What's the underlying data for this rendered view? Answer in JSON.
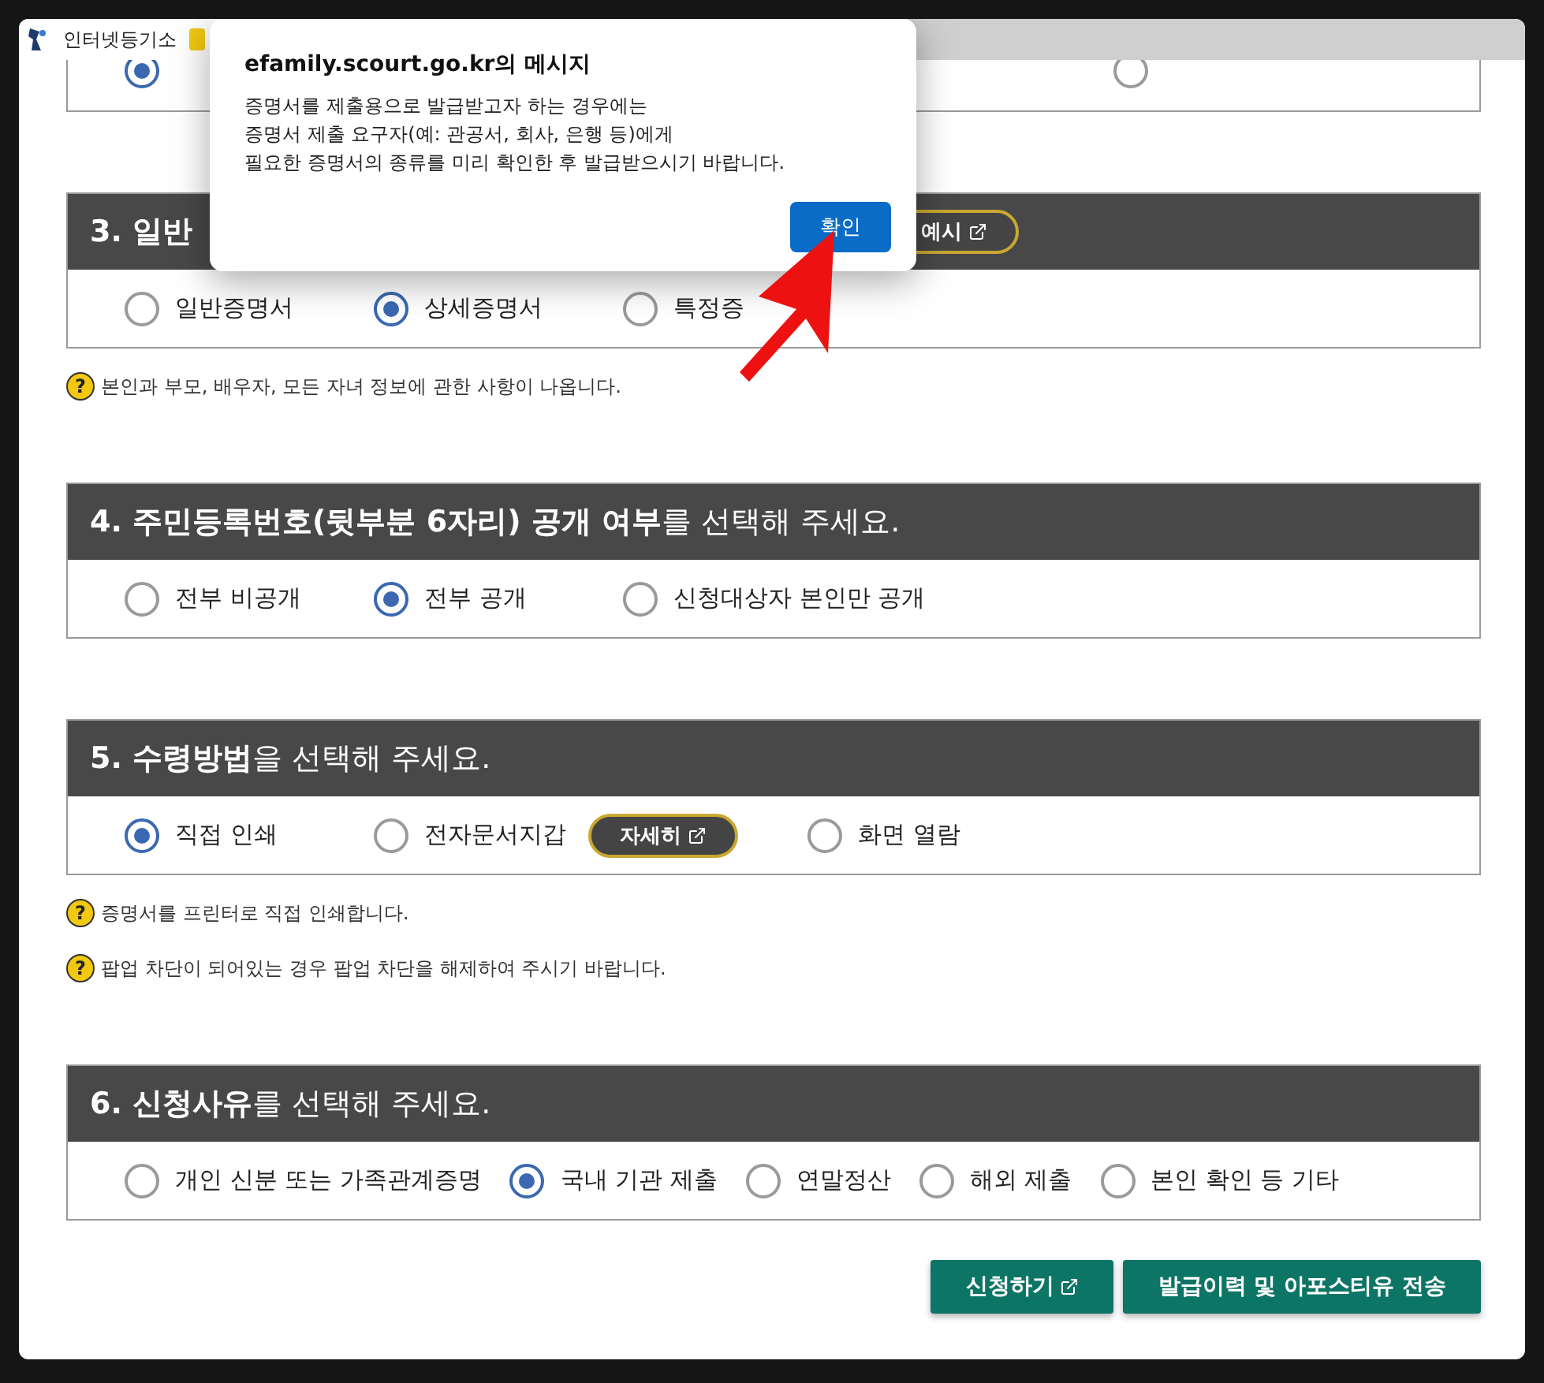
{
  "bookmark_bar": {
    "items": [
      {
        "label": "인터넷등기소"
      }
    ]
  },
  "sections": [
    {
      "kind": "spread",
      "options": [
        {
          "selected": true
        },
        {
          "selected": false
        }
      ]
    },
    {
      "kind": "wide",
      "title": "**3. 일반**",
      "header_button": "예시",
      "options": [
        {
          "label": "일반증명서",
          "selected": false
        },
        {
          "label": "상세증명서",
          "selected": true
        },
        {
          "label": "특정증",
          "selected": false
        }
      ],
      "notes": [
        {
          "icon": "?",
          "text": "본인과 부모, 배우자, 모든 자녀 정보에 관한 사항이 나옵니다."
        }
      ]
    },
    {
      "kind": "wide",
      "title": "**4. 주민등록번호(뒷부분 6자리) 공개 여부**를 선택해 주세요.",
      "options": [
        {
          "label": "전부 비공개",
          "selected": false
        },
        {
          "label": "전부 공개",
          "selected": true
        },
        {
          "label": "신청대상자 본인만 공개",
          "selected": false
        }
      ]
    },
    {
      "kind": "wide",
      "title": "**5. 수령방법**을 선택해 주세요.",
      "options": [
        {
          "label": "직접 인쇄",
          "selected": true
        },
        {
          "label": "전자문서지갑",
          "selected": false,
          "button": "자세히"
        },
        {
          "label": "화면 열람",
          "selected": false
        }
      ],
      "notes": [
        {
          "icon": "?",
          "text": "증명서를 프린터로 직접 인쇄합니다."
        },
        {
          "icon": "?",
          "text": "팝업 차단이 되어있는 경우 팝업 차단을 해제하여 주시기 바랍니다."
        }
      ]
    },
    {
      "kind": "compact",
      "title": "**6. 신청사유**를 선택해 주세요.",
      "options": [
        {
          "label": "개인 신분 또는 가족관계증명",
          "selected": false
        },
        {
          "label": "국내 기관 제출",
          "selected": true
        },
        {
          "label": "연말정산",
          "selected": false
        },
        {
          "label": "해외 제출",
          "selected": false
        },
        {
          "label": "본인 확인 등 기타",
          "selected": false
        }
      ]
    }
  ],
  "actions": [
    {
      "label": "신청하기",
      "external": true
    },
    {
      "label": "발급이력 및 아포스티유 전송",
      "external": false
    }
  ],
  "dialog": {
    "title": "efamily.scourt.go.kr의 메시지",
    "lines": [
      "증명서를 제출용으로 발급받고자 하는 경우에는",
      "증명서 제출 요구자(예: 관공서, 회사, 은행 등)에게",
      "필요한 증명서의 종류를 미리 확인한 후 발급받으시기 바랍니다."
    ],
    "button": "확인"
  }
}
